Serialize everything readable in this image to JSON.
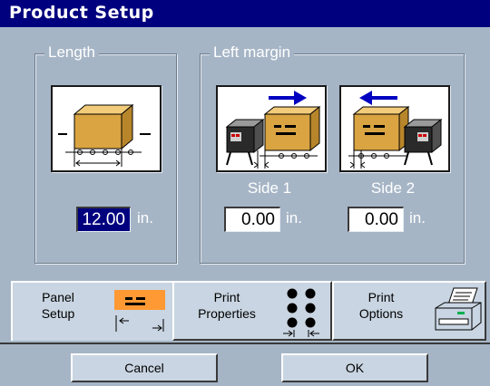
{
  "window": {
    "title": "Product Setup"
  },
  "length_group": {
    "label": "Length",
    "icon": "box-length-icon",
    "value": "12.00",
    "unit": "in."
  },
  "left_margin_group": {
    "label": "Left margin",
    "side1": {
      "label": "Side 1",
      "icon": "printer-left-side1-icon",
      "value": "0.00",
      "unit": "in."
    },
    "side2": {
      "label": "Side 2",
      "icon": "printer-right-side2-icon",
      "value": "0.00",
      "unit": "in."
    }
  },
  "tabs": [
    {
      "line1": "Panel",
      "line2": "Setup",
      "icon": "panel-setup-icon",
      "active": true
    },
    {
      "line1": "Print",
      "line2": "Properties",
      "icon": "print-properties-icon",
      "active": false
    },
    {
      "line1": "Print",
      "line2": "Options",
      "icon": "printer-icon",
      "active": false
    }
  ],
  "buttons": {
    "cancel": "Cancel",
    "ok": "OK"
  },
  "colors": {
    "title_bar": "#00007f",
    "background": "#a6b5c6",
    "box": "#d9a441",
    "arrow": "#0000c0",
    "panel_orange": "#ff9933"
  }
}
